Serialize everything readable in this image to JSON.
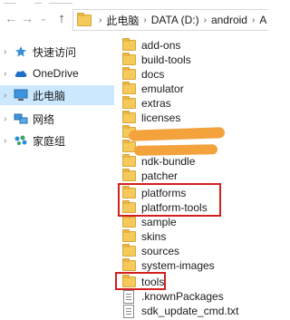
{
  "address_bar": {
    "breadcrumbs": [
      "此电脑",
      "DATA (D:)",
      "android",
      "A"
    ]
  },
  "nav_buttons": {
    "back": "←",
    "forward": "→",
    "recent": "⌄",
    "up": "↑"
  },
  "sidebar": {
    "items": [
      {
        "label": "快速访问",
        "icon": "star-icon",
        "selected": false
      },
      {
        "label": "OneDrive",
        "icon": "cloud-icon",
        "selected": false
      },
      {
        "label": "此电脑",
        "icon": "computer-icon",
        "selected": true
      },
      {
        "label": "网络",
        "icon": "network-icon",
        "selected": false
      },
      {
        "label": "家庭组",
        "icon": "homegroup-icon",
        "selected": false
      }
    ]
  },
  "files": [
    {
      "name": "add-ons",
      "type": "folder"
    },
    {
      "name": "build-tools",
      "type": "folder"
    },
    {
      "name": "docs",
      "type": "folder"
    },
    {
      "name": "emulator",
      "type": "folder"
    },
    {
      "name": "extras",
      "type": "folder"
    },
    {
      "name": "licenses",
      "type": "folder"
    },
    {
      "name": "",
      "type": "folder"
    },
    {
      "name": "",
      "type": "folder"
    },
    {
      "name": "ndk-bundle",
      "type": "folder"
    },
    {
      "name": "patcher",
      "type": "folder"
    },
    {
      "name": "platforms",
      "type": "folder"
    },
    {
      "name": "platform-tools",
      "type": "folder"
    },
    {
      "name": "sample",
      "type": "folder"
    },
    {
      "name": "skins",
      "type": "folder"
    },
    {
      "name": "sources",
      "type": "folder"
    },
    {
      "name": "system-images",
      "type": "folder"
    },
    {
      "name": "tools",
      "type": "folder"
    },
    {
      "name": ".knownPackages",
      "type": "file"
    },
    {
      "name": "sdk_update_cmd.txt",
      "type": "file"
    }
  ],
  "colors": {
    "selection": "#cce8ff",
    "highlight_box": "#d22020",
    "redaction": "#f3a23c",
    "folder": "#f6c95b"
  }
}
